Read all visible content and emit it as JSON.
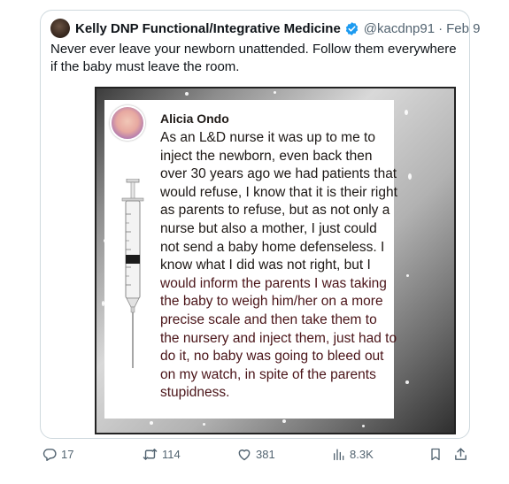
{
  "tweet": {
    "author_name": "Kelly DNP Functional/Integrative Medicine",
    "handle": "@kacdnp91",
    "separator": "·",
    "date": "Feb 9",
    "text": "Never ever leave your newborn unattended. Follow them everywhere if the baby must leave the room."
  },
  "media": {
    "post_author": "Alicia Ondo",
    "post_text_dark": "As an L&D nurse it was up to me to inject the newborn, even back then over 30 years ago we had patients that would refuse, I know that it is their right as parents to refuse, but as not only a nurse but also a mother, I just could not send a baby home defenseless.  I know what I did was not right, but I ",
    "post_text_maroon": "would inform the parents I was taking the baby to weigh him/her on a more precise scale and then take them to the nursery and inject them, just had to do it, no baby was going to bleed out on my watch, in spite of the parents stupidness."
  },
  "actions": {
    "replies": "17",
    "reposts": "114",
    "likes": "381",
    "views": "8.3K"
  },
  "colors": {
    "text_primary": "#0f1419",
    "text_secondary": "#536471",
    "verified": "#1d9bf0",
    "border": "#cfd9de",
    "maroon_text": "#4a1418"
  }
}
